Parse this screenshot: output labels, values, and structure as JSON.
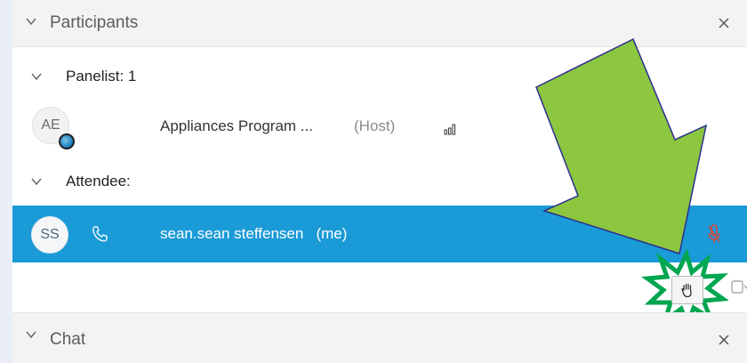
{
  "participants_section": {
    "title": "Participants",
    "groups": [
      {
        "label": "Panelist: 1",
        "members": [
          {
            "initials": "AE",
            "name": "Appliances Program ...",
            "role": "(Host)"
          }
        ]
      },
      {
        "label": "Attendee:",
        "members": [
          {
            "initials": "SS",
            "name": "sean.sean steffensen",
            "suffix": "(me)"
          }
        ]
      }
    ]
  },
  "chat_section": {
    "title": "Chat"
  },
  "icons": {
    "collapse": "chevron-down-icon",
    "close": "close-icon",
    "phone": "phone-icon",
    "mic": "microphone-muted-icon",
    "raise_hand": "raise-hand-icon",
    "signal": "signal-strength-icon",
    "callout_arrow": "arrow-annotation",
    "callout_burst": "starburst-highlight"
  },
  "colors": {
    "selected_row": "#1a9ad6",
    "arrow_fill": "#8dc63f",
    "arrow_stroke": "#2b2f8f",
    "burst_stroke": "#00a650",
    "muted_mic": "#d9453b"
  }
}
